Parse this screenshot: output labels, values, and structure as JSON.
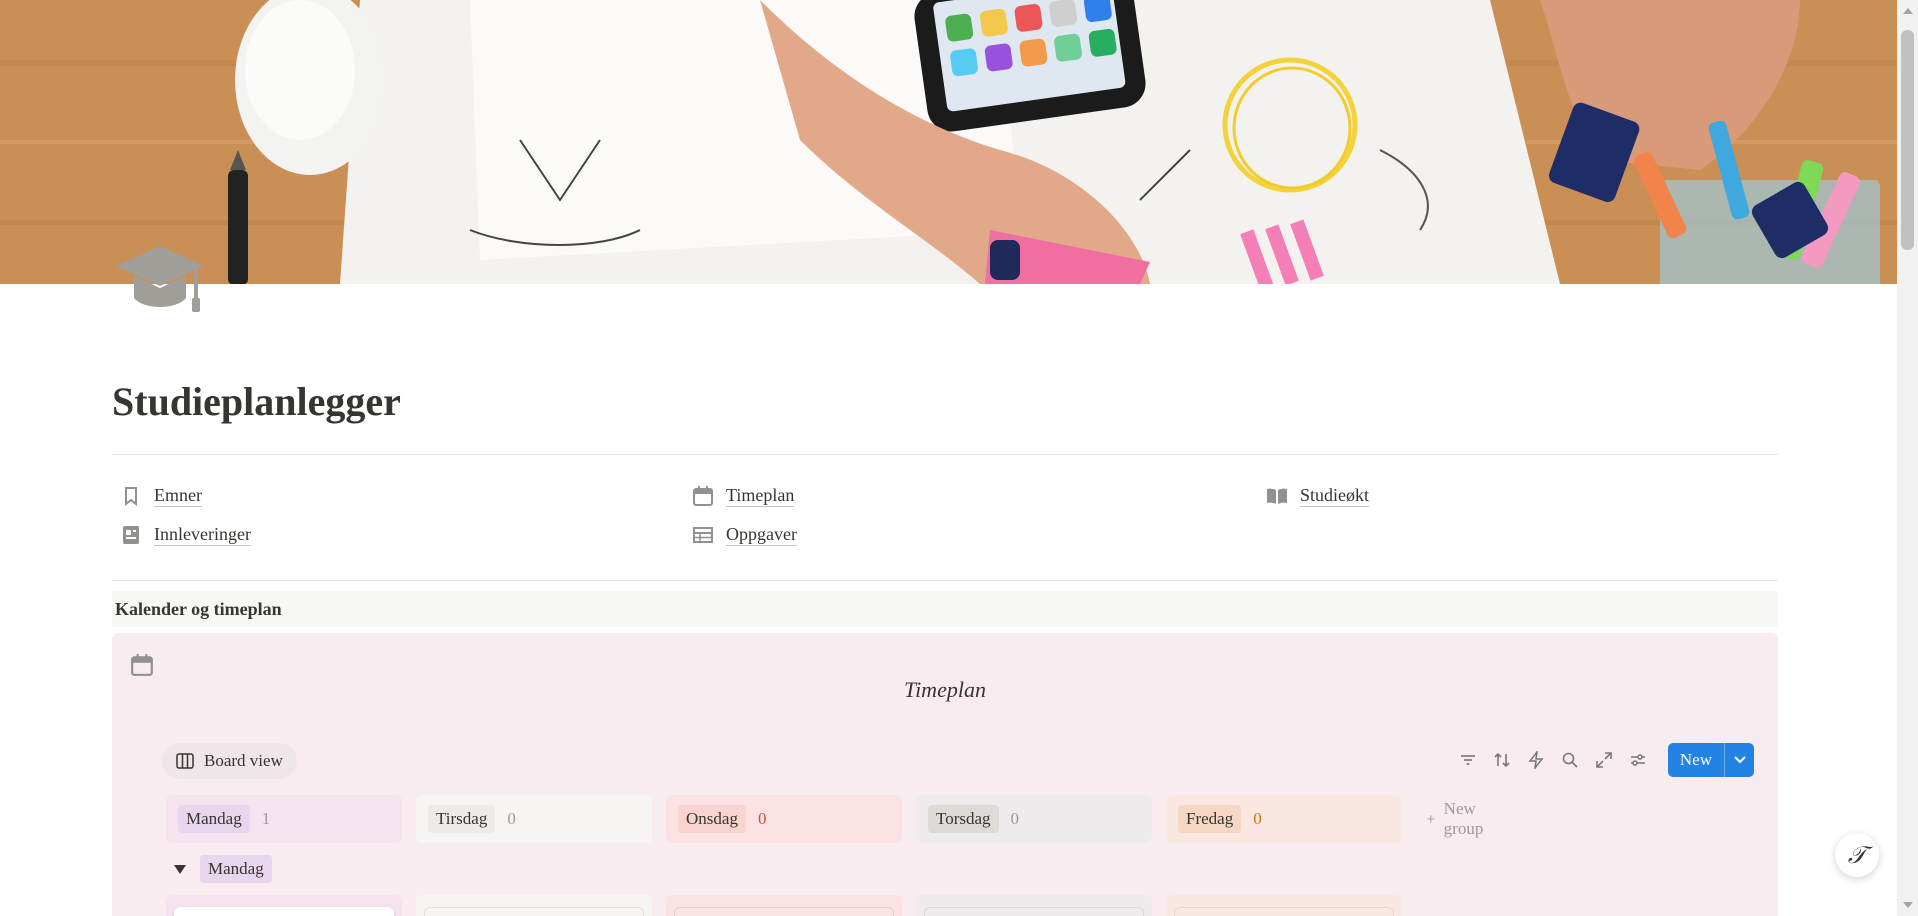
{
  "page": {
    "title": "Studieplanlegger",
    "icon": "graduation-cap-icon"
  },
  "links": [
    {
      "label": "Emner",
      "icon": "bookmark-icon"
    },
    {
      "label": "Timeplan",
      "icon": "calendar-icon"
    },
    {
      "label": "Studieøkt",
      "icon": "open-book-icon"
    },
    {
      "label": "Innleveringer",
      "icon": "document-icon"
    },
    {
      "label": "Oppgaver",
      "icon": "table-icon"
    }
  ],
  "section": {
    "heading": "Kalender og timeplan"
  },
  "database": {
    "title": "Timeplan",
    "icon": "calendar-icon",
    "view_label": "Board view",
    "new_label": "New",
    "new_group_label": "New group",
    "groups": [
      {
        "label": "Mandag",
        "count": "1",
        "pill_color": "#e8d5ee",
        "lane_color": "#f5e4ef",
        "count_color": "#9b9a97"
      },
      {
        "label": "Tirsdag",
        "count": "0",
        "pill_color": "#ecebe9",
        "lane_color": "#f7f5f4",
        "count_color": "#9b9a97"
      },
      {
        "label": "Onsdag",
        "count": "0",
        "pill_color": "#f8d3cf",
        "lane_color": "#fbe2e3",
        "count_color": "#d44c47"
      },
      {
        "label": "Torsdag",
        "count": "0",
        "pill_color": "#dddbd8",
        "lane_color": "#efebec",
        "count_color": "#9b9a97"
      },
      {
        "label": "Fredag",
        "count": "0",
        "pill_color": "#f6d7c3",
        "lane_color": "#fbe7e2",
        "count_color": "#d9730d"
      }
    ],
    "subgroup_label": "Mandag"
  },
  "colors": {
    "accent": "#2383e2",
    "callout_bg": "#f9ecf1"
  }
}
